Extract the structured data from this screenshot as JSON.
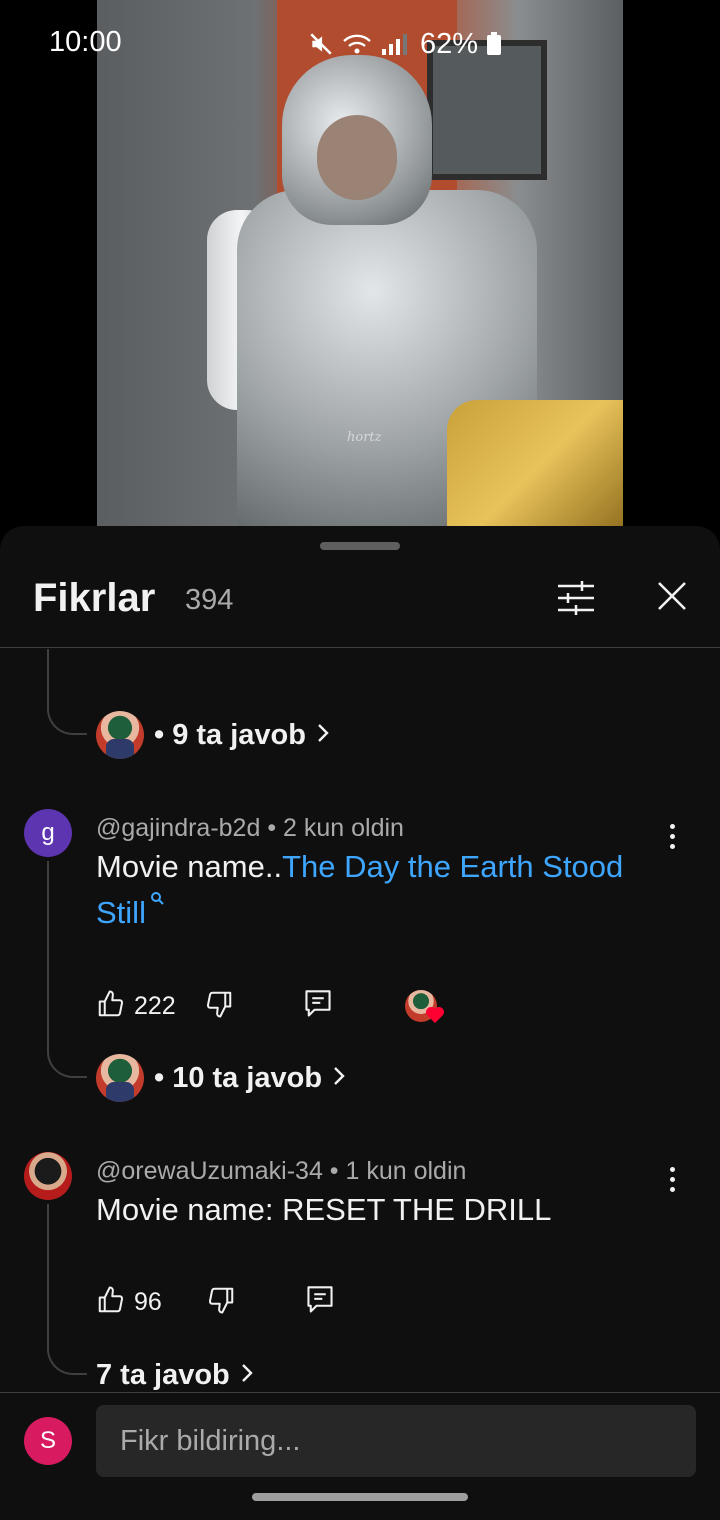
{
  "status_bar": {
    "time": "10:00",
    "battery": "62%",
    "icons": [
      "mute-icon",
      "wifi-icon",
      "signal-icon",
      "battery-icon"
    ]
  },
  "video": {
    "watermark": "hortz"
  },
  "sheet": {
    "title": "Fikrlar",
    "count": "394",
    "icons": [
      "filter-icon",
      "close-icon"
    ]
  },
  "threads": [
    {
      "replies_label": "• 9 ta javob"
    },
    {
      "author": "@gajindra-b2d",
      "time": "2 kun oldin",
      "avatar_letter": "g",
      "text_plain": "Movie name..",
      "text_link": "The Day the Earth Stood Still",
      "likes": "222",
      "replies_label": "• 10 ta javob"
    },
    {
      "author": "@orewaUzumaki-34",
      "time": "1 kun oldin",
      "text": "Movie name: RESET THE DRILL",
      "likes": "96",
      "replies_label": "7 ta javob"
    }
  ],
  "composer": {
    "avatar_letter": "S",
    "placeholder": "Fikr bildiring..."
  },
  "colors": {
    "link": "#3ea6ff",
    "sheet_bg": "#0f0f0f",
    "secondary_text": "#aaaaaa"
  }
}
